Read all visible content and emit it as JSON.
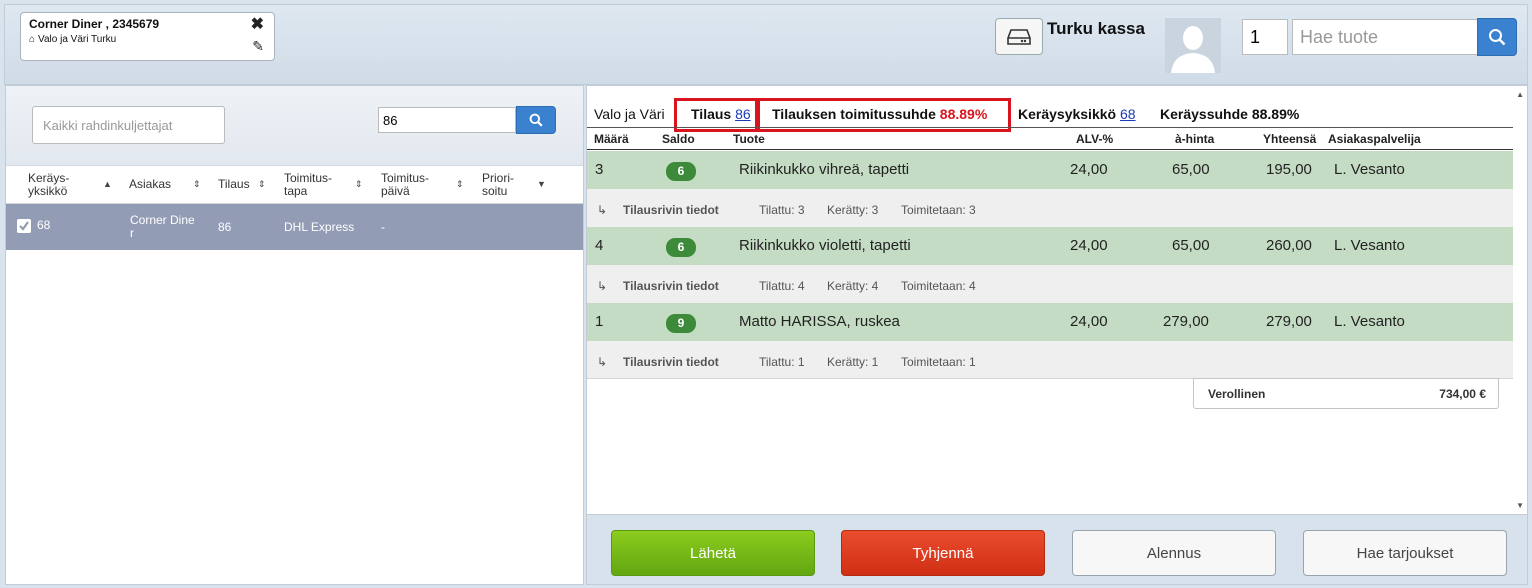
{
  "customer": {
    "name": "Corner Diner , 2345679",
    "store": "Valo ja Väri Turku"
  },
  "header": {
    "register_name": "Turku kassa",
    "quantity": "1",
    "product_search_placeholder": "Hae tuote"
  },
  "left": {
    "carrier_placeholder": "Kaikki rahdinkuljettajat",
    "order_search_value": "86",
    "columns": {
      "unit_1": "Keräys-",
      "unit_2": "yksikkö",
      "customer": "Asiakas",
      "order": "Tilaus",
      "delivery_1": "Toimitus-",
      "delivery_2": "tapa",
      "date_1": "Toimitus-",
      "date_2": "päivä",
      "priority_1": "Priori-",
      "priority_2": "soitu"
    },
    "row": {
      "unit": "68",
      "customer_1": "Corner Dine",
      "customer_2": "r",
      "order": "86",
      "delivery": "DHL Express",
      "date": "-"
    }
  },
  "summary": {
    "store": "Valo ja Väri",
    "order_label": "Tilaus",
    "order_value": "86",
    "fulfil_label": "Tilauksen toimitussuhde",
    "fulfil_value": "88.89%",
    "unit_label": "Keräysyksikkö",
    "unit_value": "68",
    "pick_label": "Keräyssuhde 88.89%"
  },
  "columns": {
    "qty": "Määrä",
    "saldo": "Saldo",
    "product": "Tuote",
    "vat": "ALV-%",
    "price": "à-hinta",
    "total": "Yhteensä",
    "agent": "Asiakaspalvelija"
  },
  "rows": [
    {
      "qty": "3",
      "saldo": "6",
      "product": "Riikinkukko vihreä, tapetti",
      "vat": "24,00",
      "price": "65,00",
      "total": "195,00",
      "agent": "L. Vesanto",
      "sub_label": "Tilausrivin tiedot",
      "ordered": "Tilattu: 3",
      "picked": "Kerätty: 3",
      "delivered": "Toimitetaan: 3"
    },
    {
      "qty": "4",
      "saldo": "6",
      "product": "Riikinkukko violetti, tapetti",
      "vat": "24,00",
      "price": "65,00",
      "total": "260,00",
      "agent": "L. Vesanto",
      "sub_label": "Tilausrivin tiedot",
      "ordered": "Tilattu: 4",
      "picked": "Kerätty: 4",
      "delivered": "Toimitetaan: 4"
    },
    {
      "qty": "1",
      "saldo": "9",
      "product": "Matto HARISSA, ruskea",
      "vat": "24,00",
      "price": "279,00",
      "total": "279,00",
      "agent": "L. Vesanto",
      "sub_label": "Tilausrivin tiedot",
      "ordered": "Tilattu: 1",
      "picked": "Kerätty: 1",
      "delivered": "Toimitetaan: 1"
    }
  ],
  "totals": {
    "label": "Verollinen",
    "value": "734,00 €"
  },
  "actions": {
    "send": "Lähetä",
    "clear": "Tyhjennä",
    "discount": "Alennus",
    "offers": "Hae tarjoukset"
  },
  "icons": {
    "home": "home-icon",
    "close": "close-icon",
    "edit": "pencil-icon",
    "drive": "drive-icon",
    "search": "search-icon",
    "check": "checkbox-icon",
    "sub_arrow": "sub-arrow-icon"
  },
  "colors": {
    "send": "#62a611",
    "clear": "#cf2f14",
    "highlight": "#d9141e",
    "row_green": "#c5dcc4",
    "badge_green": "#3d8a3a",
    "selected_row": "#939cb5",
    "search_blue": "#3a82cf"
  }
}
